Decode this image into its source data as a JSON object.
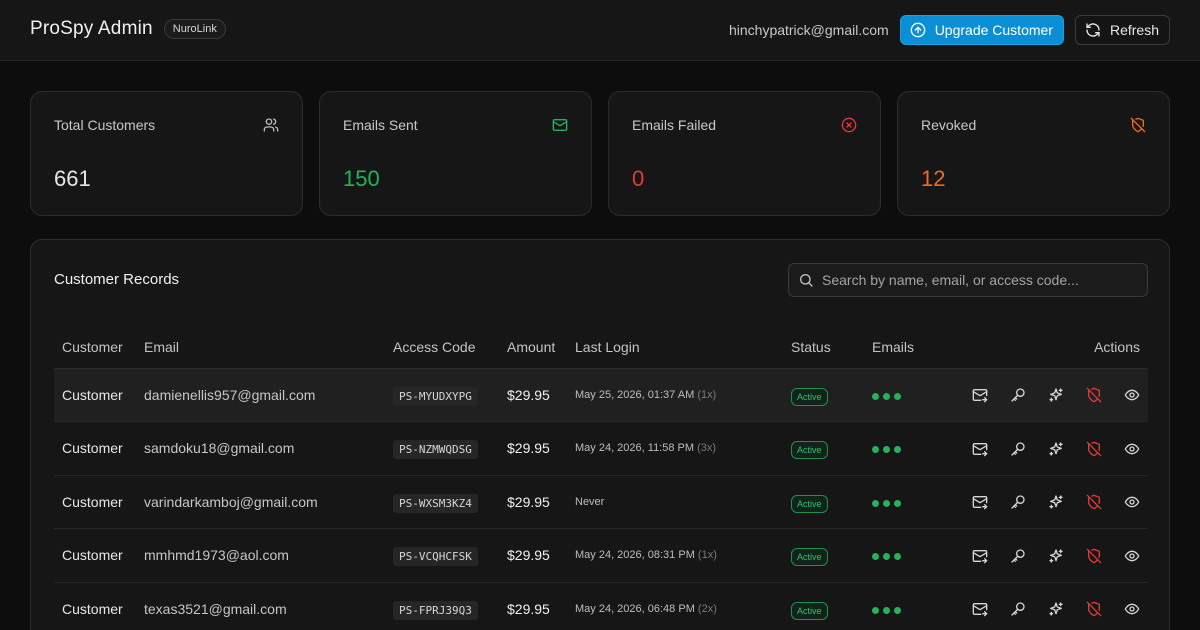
{
  "header": {
    "title": "ProSpy Admin",
    "badge": "NuroLink",
    "user_email": "hinchypatrick@gmail.com",
    "upgrade_label": "Upgrade Customer",
    "refresh_label": "Refresh"
  },
  "stats": [
    {
      "label": "Total Customers",
      "value": "661",
      "color": "#e8e8e8",
      "icon": "users-icon"
    },
    {
      "label": "Emails Sent",
      "value": "150",
      "color": "#22b35c",
      "icon": "mail-icon"
    },
    {
      "label": "Emails Failed",
      "value": "0",
      "color": "#e5383b",
      "icon": "x-circle-icon"
    },
    {
      "label": "Revoked",
      "value": "12",
      "color": "#ee6a1f",
      "icon": "shield-off-icon"
    }
  ],
  "records": {
    "title": "Customer Records",
    "search_placeholder": "Search by name, email, or access code...",
    "columns": [
      "Customer",
      "Email",
      "Access Code",
      "Amount",
      "Last Login",
      "Status",
      "Emails",
      "Actions"
    ],
    "rows": [
      {
        "customer": "Customer",
        "email": "damienellis957@gmail.com",
        "code": "PS-MYUDXYPG",
        "amount": "$29.95",
        "login": "May 25, 2026, 01:37 AM",
        "login_count": "(1x)",
        "status": "Active"
      },
      {
        "customer": "Customer",
        "email": "samdoku18@gmail.com",
        "code": "PS-NZMWQDSG",
        "amount": "$29.95",
        "login": "May 24, 2026, 11:58 PM",
        "login_count": "(3x)",
        "status": "Active"
      },
      {
        "customer": "Customer",
        "email": "varindarkamboj@gmail.com",
        "code": "PS-WXSM3KZ4",
        "amount": "$29.95",
        "login": "Never",
        "login_count": "",
        "status": "Active"
      },
      {
        "customer": "Customer",
        "email": "mmhmd1973@aol.com",
        "code": "PS-VCQHCFSK",
        "amount": "$29.95",
        "login": "May 24, 2026, 08:31 PM",
        "login_count": "(1x)",
        "status": "Active"
      },
      {
        "customer": "Customer",
        "email": "texas3521@gmail.com",
        "code": "PS-FPRJ39Q3",
        "amount": "$29.95",
        "login": "May 24, 2026, 06:48 PM",
        "login_count": "(2x)",
        "status": "Active"
      }
    ]
  },
  "colors": {
    "accent": "#0a8fd6",
    "success": "#22b35c",
    "danger": "#e5383b",
    "warning": "#ee6a1f"
  }
}
